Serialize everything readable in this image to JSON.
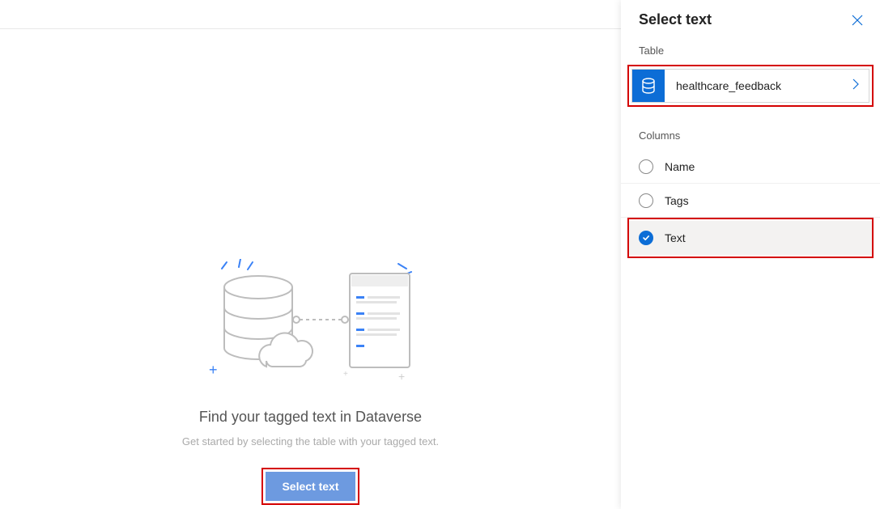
{
  "main": {
    "heading": "Find your tagged text in Dataverse",
    "subheading": "Get started by selecting the table with your tagged text.",
    "button_label": "Select text"
  },
  "panel": {
    "title": "Select text",
    "section_table_label": "Table",
    "table": {
      "name": "healthcare_feedback"
    },
    "section_columns_label": "Columns",
    "columns": [
      {
        "label": "Name",
        "selected": false
      },
      {
        "label": "Tags",
        "selected": false
      },
      {
        "label": "Text",
        "selected": true
      }
    ]
  },
  "colors": {
    "accent": "#0c6dd6",
    "highlight": "#d40000",
    "button_bg": "#6d9ae0"
  }
}
